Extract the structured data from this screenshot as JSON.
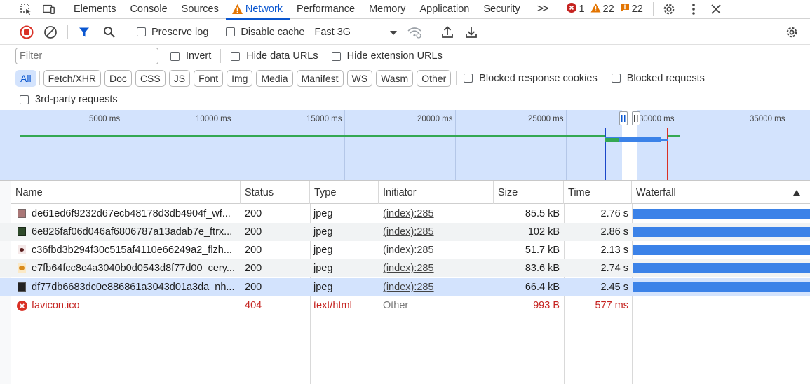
{
  "tabs": [
    {
      "label": "Elements"
    },
    {
      "label": "Console"
    },
    {
      "label": "Sources"
    },
    {
      "label": "Network"
    },
    {
      "label": "Performance"
    },
    {
      "label": "Memory"
    },
    {
      "label": "Application"
    },
    {
      "label": "Security"
    }
  ],
  "tab_more": ">>",
  "counts": {
    "errors": "1",
    "warnings": "22",
    "issues": "22"
  },
  "toolbar": {
    "preserve_log": "Preserve log",
    "disable_cache": "Disable cache",
    "throttle": "Fast 3G"
  },
  "filter": {
    "placeholder": "Filter",
    "invert": "Invert",
    "hide_data_urls": "Hide data URLs",
    "hide_extension_urls": "Hide extension URLs"
  },
  "type_filters": [
    "All",
    "Fetch/XHR",
    "Doc",
    "CSS",
    "JS",
    "Font",
    "Img",
    "Media",
    "Manifest",
    "WS",
    "Wasm",
    "Other"
  ],
  "blocked_response_cookies": "Blocked response cookies",
  "blocked_requests": "Blocked requests",
  "third_party": "3rd-party requests",
  "overview_ticks": [
    "5000 ms",
    "10000 ms",
    "15000 ms",
    "20000 ms",
    "25000 ms",
    "30000 ms",
    "35000 ms"
  ],
  "columns": [
    "Name",
    "Status",
    "Type",
    "Initiator",
    "Size",
    "Time",
    "Waterfall"
  ],
  "rows": [
    {
      "name": "de61ed6f9232d67ecb48178d3db4904f_wf...",
      "status": "200",
      "type": "jpeg",
      "initiator": "(index):285",
      "size": "85.5 kB",
      "time": "2.76 s"
    },
    {
      "name": "6e826faf06d046af6806787a13adab7e_ftrx...",
      "status": "200",
      "type": "jpeg",
      "initiator": "(index):285",
      "size": "102 kB",
      "time": "2.86 s"
    },
    {
      "name": "c36fbd3b294f30c515af4110e66249a2_flzh...",
      "status": "200",
      "type": "jpeg",
      "initiator": "(index):285",
      "size": "51.7 kB",
      "time": "2.13 s"
    },
    {
      "name": "e7fb64fcc8c4a3040b0d0543d8f77d00_cery...",
      "status": "200",
      "type": "jpeg",
      "initiator": "(index):285",
      "size": "83.6 kB",
      "time": "2.74 s"
    },
    {
      "name": "df77db6683dc0e886861a3043d01a3da_nh...",
      "status": "200",
      "type": "jpeg",
      "initiator": "(index):285",
      "size": "66.4 kB",
      "time": "2.45 s"
    },
    {
      "name": "favicon.ico",
      "status": "404",
      "type": "text/html",
      "initiator": "Other",
      "size": "993 B",
      "time": "577 ms"
    }
  ],
  "colors": {
    "accent": "#0b57d0",
    "error": "#c5221f",
    "warning": "#e37400",
    "bar": "#3b82e8"
  }
}
